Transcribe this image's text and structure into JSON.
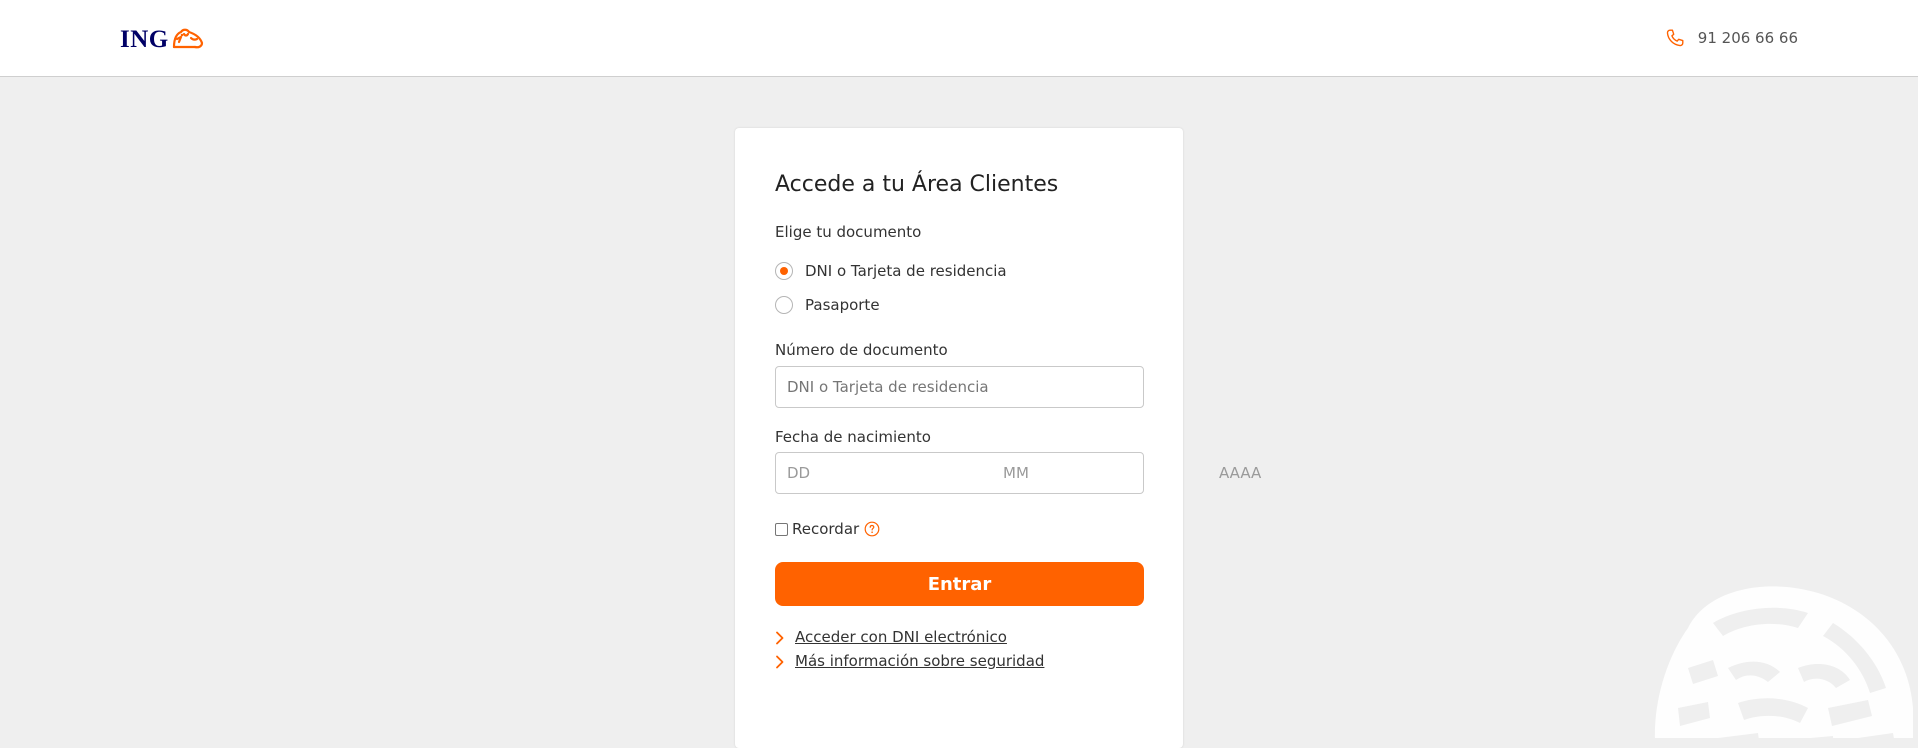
{
  "header": {
    "logo_text": "ING",
    "logo_icon": "lion-icon",
    "phone_icon": "phone-icon",
    "phone_number": "91 206 66 66"
  },
  "login": {
    "title": "Accede a tu Área Clientes",
    "document_label": "Elige tu documento",
    "document_options": [
      {
        "label": "DNI o Tarjeta de residencia",
        "selected": true
      },
      {
        "label": "Pasaporte",
        "selected": false
      }
    ],
    "document_number_label": "Número de documento",
    "document_number_placeholder": "DNI o Tarjeta de residencia",
    "document_number_value": "",
    "birthdate_label": "Fecha de nacimiento",
    "birthdate_day_placeholder": "DD",
    "birthdate_month_placeholder": "MM",
    "birthdate_year_placeholder": "AAAA",
    "remember_label": "Recordar",
    "remember_checked": false,
    "help_icon": "question-circle-icon",
    "submit_label": "Entrar",
    "links": [
      {
        "label": "Acceder con DNI electrónico",
        "icon": "chevron-right-icon"
      },
      {
        "label": "Más información sobre seguridad",
        "icon": "chevron-right-icon"
      }
    ]
  },
  "colors": {
    "accent": "#ff6200",
    "brand_blue": "#000066",
    "background": "#efefef"
  }
}
